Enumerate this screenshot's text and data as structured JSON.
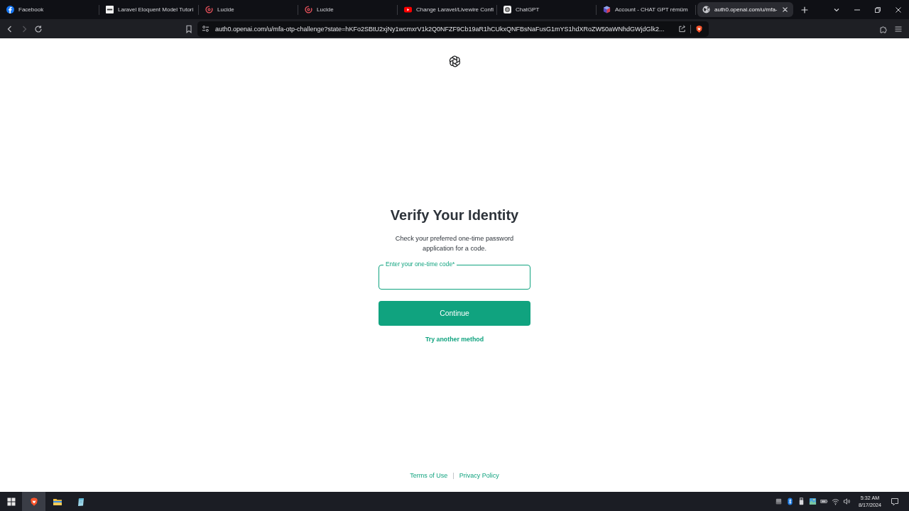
{
  "browser": {
    "tabs": [
      {
        "title": "Facebook",
        "selected": false
      },
      {
        "title": "Laravel Eloquent Model Tutori",
        "selected": false
      },
      {
        "title": "Lucide",
        "selected": false
      },
      {
        "title": "Lucide",
        "selected": false
      },
      {
        "title": "Change Laravel/Livewire Confi",
        "selected": false
      },
      {
        "title": "ChatGPT",
        "selected": false
      },
      {
        "title": "Account - CHAT GPT rémüm",
        "selected": false
      },
      {
        "title": "auth0.openai.com/u/mfa-",
        "selected": true
      }
    ],
    "toolbar": {
      "back": {
        "disabled": false
      },
      "forward": {
        "disabled": true
      }
    },
    "address_bar": {
      "url": "auth0.openai.com/u/mfa-otp-challenge?state=hKFo2SBtU2xjNy1wcmxrV1k2Q0NFZF9Cb19aR1hCUkxQNFBsNaFusG1mYS1hdXRoZW50aWNhdGWjdGlk2..."
    }
  },
  "page": {
    "heading": "Verify Your Identity",
    "description": "Check your preferred one-time password application for a code.",
    "code_field": {
      "label": "Enter your one-time code*",
      "focused": true
    },
    "continue_button": "Continue",
    "alternative_link": "Try another method",
    "footer_links": [
      "Terms of Use",
      "Privacy Policy"
    ],
    "footer_separator": "|"
  },
  "taskbar": {
    "apps": [
      {
        "selected": true
      },
      {
        "selected": false
      },
      {
        "selected": false
      }
    ],
    "clock": {
      "time": "5:32 AM",
      "date": "8/17/2024"
    }
  }
}
